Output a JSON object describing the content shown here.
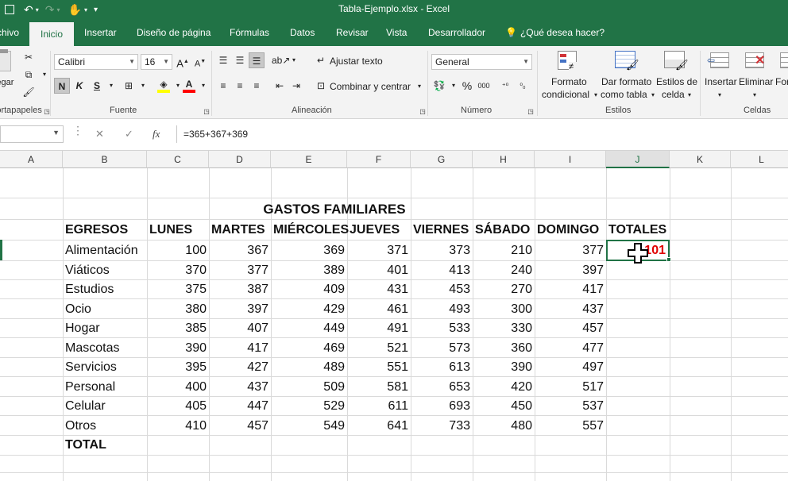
{
  "titlebar": {
    "title": "Tabla-Ejemplo.xlsx  -  Excel",
    "qat": [
      "save-icon",
      "undo-icon",
      "redo-icon",
      "touch-mode-icon",
      "customize-icon"
    ]
  },
  "tabs": [
    "Archivo",
    "Inicio",
    "Insertar",
    "Diseño de página",
    "Fórmulas",
    "Datos",
    "Revisar",
    "Vista",
    "Desarrollador"
  ],
  "tell_me": "¿Qué desea hacer?",
  "ribbon": {
    "clipboard": {
      "paste_label": "Pegar",
      "group_label": "Portapapeles"
    },
    "font": {
      "name": "Calibri",
      "size": "16",
      "bold": "N",
      "italic": "K",
      "underline": "S",
      "grow": "A",
      "shrink": "A",
      "font_color": "A",
      "group_label": "Fuente",
      "fill_color": "#ffff00",
      "text_color": "#ff0000"
    },
    "alignment": {
      "wrap_text": "Ajustar texto",
      "merge_center": "Combinar y centrar",
      "group_label": "Alineación"
    },
    "number": {
      "format": "General",
      "percent": "%",
      "thousands": "000",
      "group_label": "Número"
    },
    "styles": {
      "conditional": [
        "Formato",
        "condicional"
      ],
      "as_table": [
        "Dar formato",
        "como tabla"
      ],
      "cell_styles": [
        "Estilos de",
        "celda"
      ],
      "group_label": "Estilos"
    },
    "cells": {
      "insert": "Insertar",
      "delete": "Eliminar",
      "format": "Formato",
      "group_label": "Celdas"
    }
  },
  "formula_bar": {
    "cancel": "✕",
    "enter": "✓",
    "fx": "fx",
    "formula": "=365+367+369"
  },
  "columns": [
    "A",
    "B",
    "C",
    "D",
    "E",
    "F",
    "G",
    "H",
    "I",
    "J",
    "K",
    "L"
  ],
  "selected_column": "J",
  "sheet": {
    "title": "GASTOS FAMILIARES",
    "headers": [
      "EGRESOS",
      "LUNES",
      "MARTES",
      "MIÉRCOLES",
      "JUEVES",
      "VIERNES",
      "SÁBADO",
      "DOMINGO",
      "TOTALES"
    ],
    "rows": [
      {
        "label": "Alimentación",
        "values": [
          "100",
          "367",
          "369",
          "371",
          "373",
          "210",
          "377"
        ]
      },
      {
        "label": "Viáticos",
        "values": [
          "370",
          "377",
          "389",
          "401",
          "413",
          "240",
          "397"
        ]
      },
      {
        "label": "Estudios",
        "values": [
          "375",
          "387",
          "409",
          "431",
          "453",
          "270",
          "417"
        ]
      },
      {
        "label": "Ocio",
        "values": [
          "380",
          "397",
          "429",
          "461",
          "493",
          "300",
          "437"
        ]
      },
      {
        "label": "Hogar",
        "values": [
          "385",
          "407",
          "449",
          "491",
          "533",
          "330",
          "457"
        ]
      },
      {
        "label": "Mascotas",
        "values": [
          "390",
          "417",
          "469",
          "521",
          "573",
          "360",
          "477"
        ]
      },
      {
        "label": "Servicios",
        "values": [
          "395",
          "427",
          "489",
          "551",
          "613",
          "390",
          "497"
        ]
      },
      {
        "label": "Personal",
        "values": [
          "400",
          "437",
          "509",
          "581",
          "653",
          "420",
          "517"
        ]
      },
      {
        "label": "Celular",
        "values": [
          "405",
          "447",
          "529",
          "611",
          "693",
          "450",
          "537"
        ]
      },
      {
        "label": "Otros",
        "values": [
          "410",
          "457",
          "549",
          "641",
          "733",
          "480",
          "557"
        ]
      }
    ],
    "total_label": "TOTAL",
    "active_cell_value": "101"
  },
  "colors": {
    "excel_green": "#217346",
    "active_value": "#e00000"
  }
}
